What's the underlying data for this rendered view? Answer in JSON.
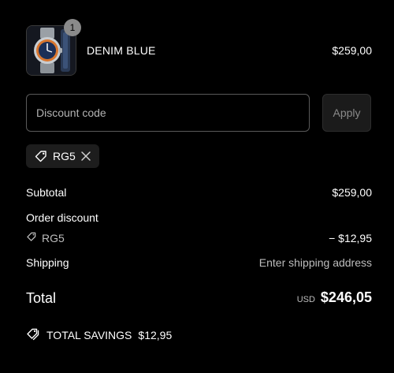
{
  "product": {
    "name": "DENIM BLUE",
    "price": "$259,00",
    "quantity": "1"
  },
  "discount": {
    "placeholder": "Discount code",
    "apply_label": "Apply",
    "applied_code": "RG5"
  },
  "summary": {
    "subtotal_label": "Subtotal",
    "subtotal_value": "$259,00",
    "order_discount_label": "Order discount",
    "discount_code": "RG5",
    "discount_value": "− $12,95",
    "shipping_label": "Shipping",
    "shipping_value": "Enter shipping address",
    "total_label": "Total",
    "currency": "USD",
    "total_value": "$246,05"
  },
  "savings": {
    "label": "TOTAL SAVINGS",
    "value": "$12,95"
  }
}
